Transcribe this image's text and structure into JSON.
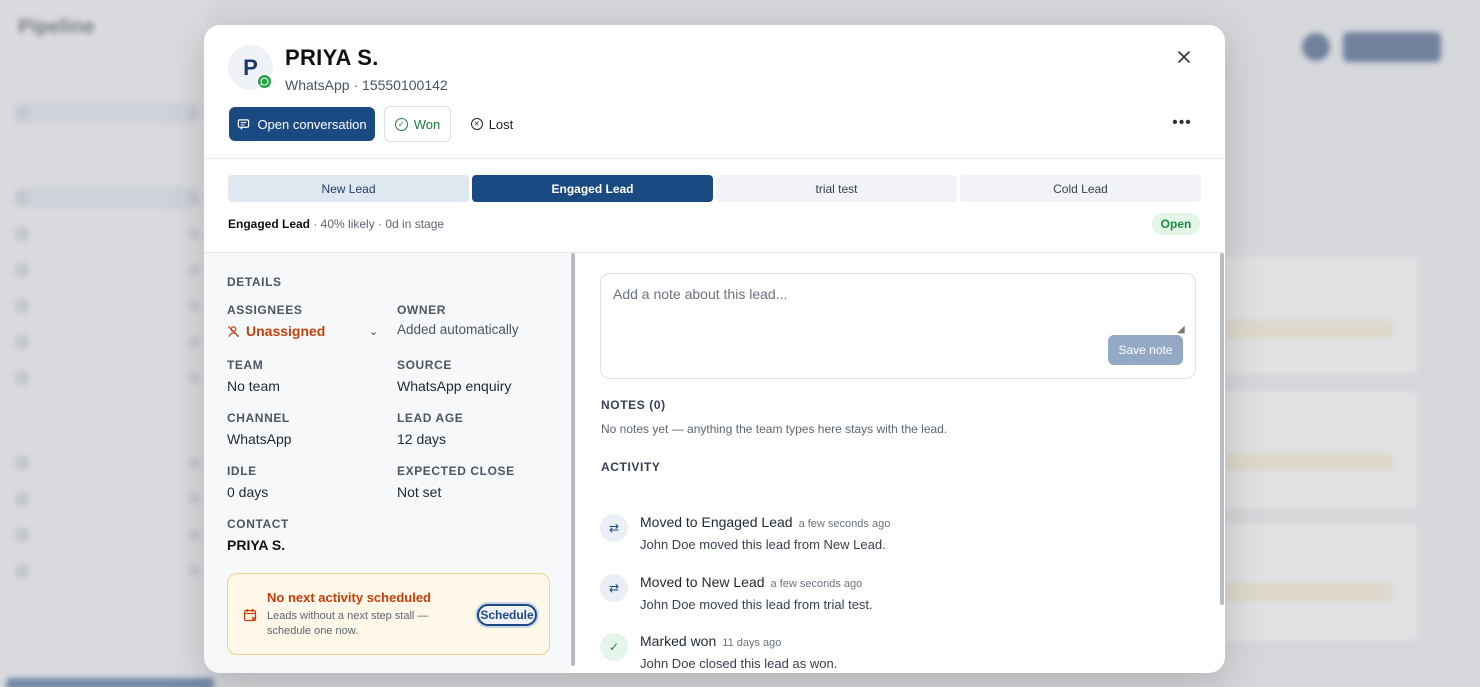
{
  "background": {
    "title": "Pipeline"
  },
  "lead": {
    "initial": "P",
    "name": "PRIYA S.",
    "subtitle": "WhatsApp · 15550100142",
    "channel_badge_icon": "whatsapp-icon"
  },
  "header": {
    "open_conversation_label": "Open conversation",
    "won_label": "Won",
    "lost_label": "Lost",
    "close_icon": "close-icon",
    "more_icon": "more-horizontal-icon"
  },
  "stages": [
    {
      "label": "New Lead",
      "state": "done"
    },
    {
      "label": "Engaged Lead",
      "state": "current"
    },
    {
      "label": "trial test",
      "state": "upcoming"
    },
    {
      "label": "Cold Lead",
      "state": "upcoming"
    }
  ],
  "stage_meta": {
    "current": "Engaged Lead",
    "rest": " · 40% likely · 0d in stage"
  },
  "status_badge": "Open",
  "details": {
    "title": "DETAILS",
    "assignees_label": "ASSIGNEES",
    "assignees_value": "Unassigned",
    "owner_label": "OWNER",
    "owner_value": "Added automatically",
    "team_label": "TEAM",
    "team_value": "No team",
    "source_label": "SOURCE",
    "source_value": "WhatsApp enquiry",
    "channel_label": "CHANNEL",
    "channel_value": "WhatsApp",
    "lead_age_label": "LEAD AGE",
    "lead_age_value": "12 days",
    "idle_label": "IDLE",
    "idle_value": "0 days",
    "expected_close_label": "EXPECTED CLOSE",
    "expected_close_value": "Not set",
    "contact_label": "CONTACT",
    "contact_value": "PRIYA S."
  },
  "alert": {
    "title": "No next activity scheduled",
    "body": "Leads without a next step stall — schedule one now.",
    "button": "Schedule"
  },
  "notes": {
    "placeholder": "Add a note about this lead...",
    "save_label": "Save note",
    "section_label": "NOTES (0)",
    "empty_text": "No notes yet — anything the team types here stays with the lead."
  },
  "activity": {
    "section_label": "ACTIVITY",
    "items": [
      {
        "title": "Moved to Engaged Lead",
        "time": "a few seconds ago",
        "desc": "John Doe moved this lead from New Lead.",
        "icon": "swap-icon"
      },
      {
        "title": "Moved to New Lead",
        "time": "a few seconds ago",
        "desc": "John Doe moved this lead from trial test.",
        "icon": "swap-icon"
      },
      {
        "title": "Marked won",
        "time": "11 days ago",
        "desc": "John Doe closed this lead as won.",
        "icon": "check-circle-icon"
      }
    ]
  },
  "colors": {
    "primary": "#1b4a82",
    "won_green": "#1f7a3a",
    "warning": "#c2410c",
    "open_badge_bg": "#e3f6e8"
  }
}
